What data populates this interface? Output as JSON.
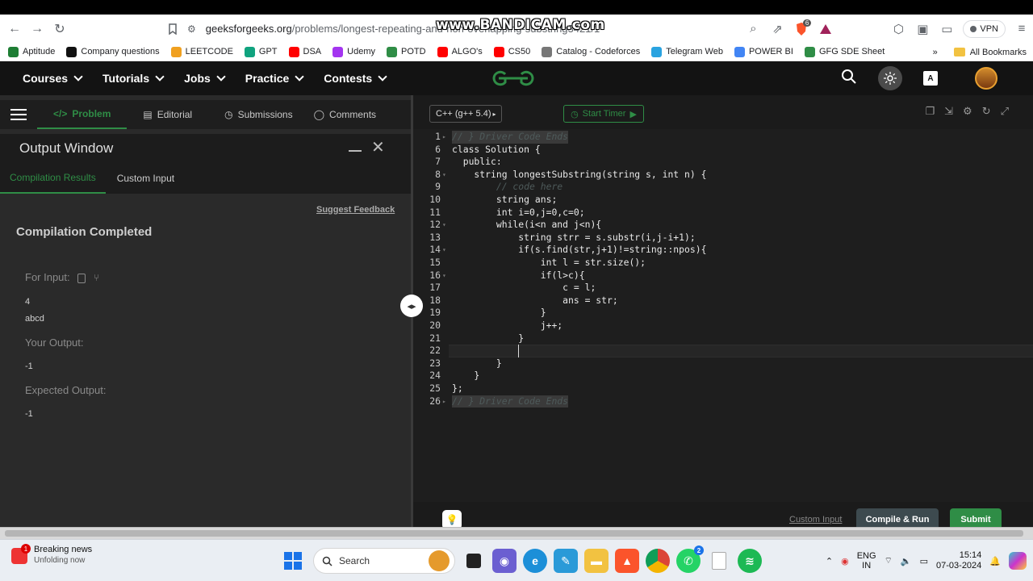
{
  "browser": {
    "url_host": "geeksforgeeks.org",
    "url_path": "/problems/longest-repeating-and-non-overlapping-substring3421/1",
    "watermark": "www.BANDICAM.com",
    "vpn_label": "VPN",
    "extension_badge": "6"
  },
  "bookmarks": {
    "items": [
      {
        "label": "Aptitude",
        "icon": "aptitude-icon",
        "color": "#1e7e34"
      },
      {
        "label": "Company questions",
        "icon": "github-icon",
        "color": "#111111"
      },
      {
        "label": "LEETCODE",
        "icon": "leetcode-icon",
        "color": "#f0a020"
      },
      {
        "label": "GPT",
        "icon": "chatgpt-icon",
        "color": "#10a37f"
      },
      {
        "label": "DSA",
        "icon": "youtube-icon",
        "color": "#ff0000"
      },
      {
        "label": "Udemy",
        "icon": "udemy-icon",
        "color": "#a435f0"
      },
      {
        "label": "POTD",
        "icon": "gfg-icon",
        "color": "#2f8d46"
      },
      {
        "label": "ALGO's",
        "icon": "youtube-icon",
        "color": "#ff0000"
      },
      {
        "label": "CS50",
        "icon": "youtube-icon",
        "color": "#ff0000"
      },
      {
        "label": "Catalog - Codeforces",
        "icon": "document-icon",
        "color": "#777777"
      },
      {
        "label": "Telegram Web",
        "icon": "telegram-icon",
        "color": "#2aa3e0"
      },
      {
        "label": "POWER BI",
        "icon": "google-icon",
        "color": "#4285f4"
      },
      {
        "label": "GFG SDE Sheet",
        "icon": "gfg-icon",
        "color": "#2f8d46"
      }
    ],
    "overflow": "»",
    "all_bookmarks": "All Bookmarks"
  },
  "header": {
    "nav": [
      "Courses",
      "Tutorials",
      "Jobs",
      "Practice",
      "Contests"
    ],
    "brand_color": "#2f8d46"
  },
  "left_panel": {
    "tabs": [
      "Problem",
      "Editorial",
      "Submissions",
      "Comments"
    ],
    "active_tab": "Problem",
    "output_window_title": "Output Window",
    "subtabs": [
      "Compilation Results",
      "Custom Input"
    ],
    "suggest_feedback": "Suggest Feedback",
    "status": "Compilation Completed",
    "for_input_label": "For Input:",
    "input_lines": [
      "4",
      "abcd"
    ],
    "your_output_label": "Your Output:",
    "your_output": "-1",
    "expected_output_label": "Expected Output:",
    "expected_output": "-1"
  },
  "editor": {
    "language": "C++ (g++ 5.4)",
    "timer_label": "Start Timer",
    "lines": [
      {
        "n": "1",
        "fold": "▸",
        "text": "// } Driver Code Ends",
        "type": "folded"
      },
      {
        "n": "6",
        "fold": "",
        "text": "class Solution {",
        "type": "code"
      },
      {
        "n": "7",
        "fold": "",
        "text": "  public:",
        "type": "code"
      },
      {
        "n": "8",
        "fold": "▾",
        "text": "    string longestSubstring(string s, int n) {",
        "type": "code"
      },
      {
        "n": "9",
        "fold": "",
        "text": "        // code here",
        "type": "comment"
      },
      {
        "n": "10",
        "fold": "",
        "text": "        string ans;",
        "type": "code"
      },
      {
        "n": "11",
        "fold": "",
        "text": "        int i=0,j=0,c=0;",
        "type": "code"
      },
      {
        "n": "12",
        "fold": "▾",
        "text": "        while(i<n and j<n){",
        "type": "code"
      },
      {
        "n": "13",
        "fold": "",
        "text": "            string strr = s.substr(i,j-i+1);",
        "type": "code"
      },
      {
        "n": "14",
        "fold": "▾",
        "text": "            if(s.find(str,j+1)!=string::npos){",
        "type": "code"
      },
      {
        "n": "15",
        "fold": "",
        "text": "                int l = str.size();",
        "type": "code"
      },
      {
        "n": "16",
        "fold": "▾",
        "text": "                if(l>c){",
        "type": "code"
      },
      {
        "n": "17",
        "fold": "",
        "text": "                    c = l;",
        "type": "code"
      },
      {
        "n": "18",
        "fold": "",
        "text": "                    ans = str;",
        "type": "code"
      },
      {
        "n": "19",
        "fold": "",
        "text": "                }",
        "type": "code"
      },
      {
        "n": "20",
        "fold": "",
        "text": "                j++;",
        "type": "code"
      },
      {
        "n": "21",
        "fold": "",
        "text": "            }",
        "type": "code"
      },
      {
        "n": "22",
        "fold": "",
        "text": "            ",
        "type": "current"
      },
      {
        "n": "23",
        "fold": "",
        "text": "        }",
        "type": "code"
      },
      {
        "n": "24",
        "fold": "",
        "text": "    }",
        "type": "code"
      },
      {
        "n": "25",
        "fold": "",
        "text": "};",
        "type": "code"
      },
      {
        "n": "26",
        "fold": "▸",
        "text": "// } Driver Code Ends",
        "type": "folded"
      }
    ],
    "custom_input": "Custom Input",
    "compile_run": "Compile & Run",
    "submit": "Submit"
  },
  "taskbar": {
    "news_title": "Breaking news",
    "news_sub": "Unfolding now",
    "news_badge": "1",
    "search_placeholder": "Search",
    "whatsapp_badge": "2",
    "lang_line1": "ENG",
    "lang_line2": "IN",
    "time": "15:14",
    "date": "07-03-2024"
  }
}
